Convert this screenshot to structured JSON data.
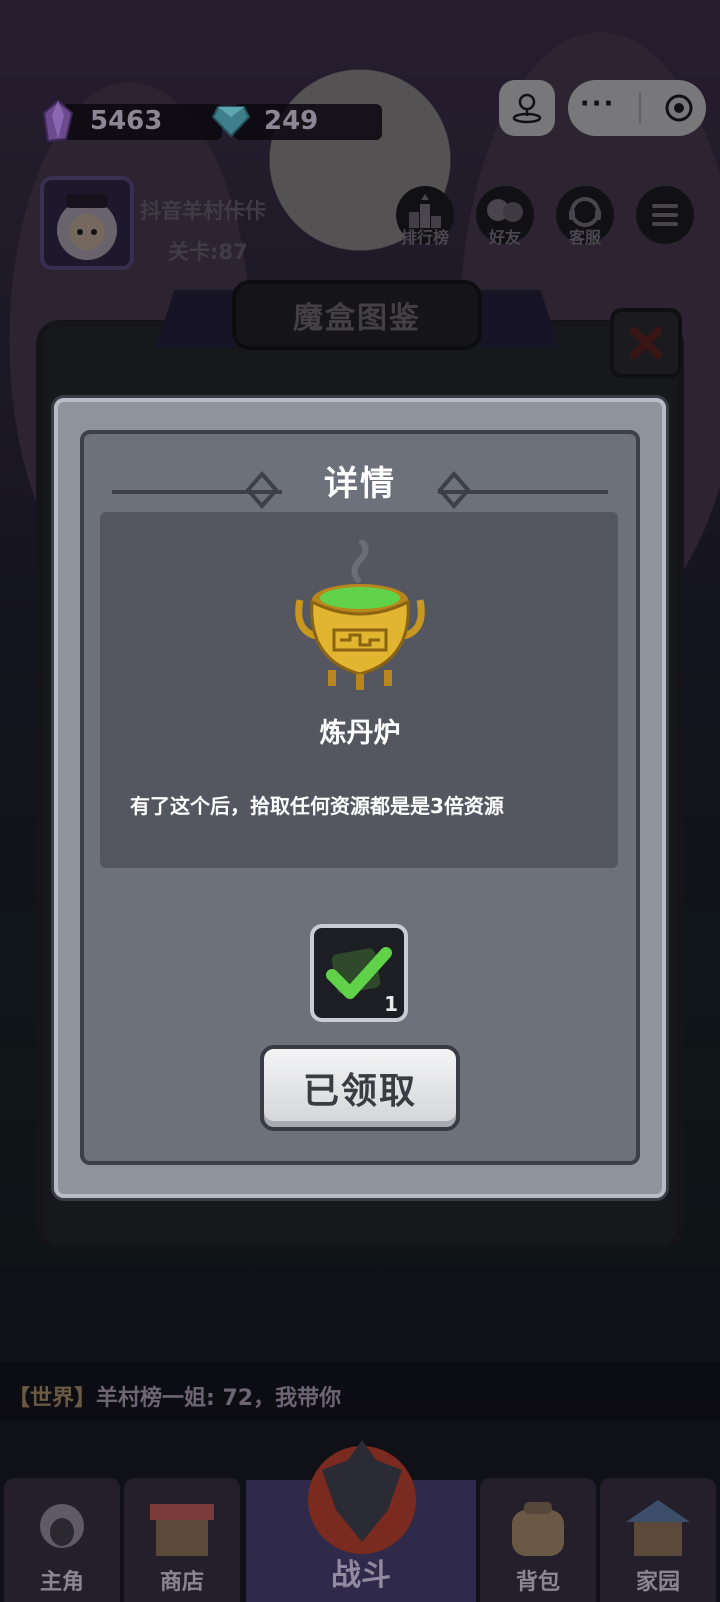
{
  "resources": {
    "crystal": {
      "icon": "purple-crystal-icon",
      "value": "5463"
    },
    "diamond": {
      "icon": "blue-diamond-icon",
      "value": "249"
    }
  },
  "miniprogram": {
    "share_icon": "joystick-icon",
    "more_icon": "more-dots-icon",
    "exit_icon": "record-target-icon"
  },
  "profile": {
    "username": "抖音羊村佧佧",
    "level": "关卡:87"
  },
  "top_menu": [
    {
      "icon": "ranking-icon",
      "label": "排行榜"
    },
    {
      "icon": "friends-icon",
      "label": "好友"
    },
    {
      "icon": "support-icon",
      "label": "客服"
    },
    {
      "icon": "menu-icon",
      "label": ""
    }
  ],
  "back_panel": {
    "title": "魔盒图鉴"
  },
  "detail_modal": {
    "title": "详情",
    "item_icon": "alchemy-furnace-icon",
    "item_name": "炼丹炉",
    "item_description": "有了这个后，拾取任何资源都是是3倍资源",
    "reward": {
      "icon": "checkmark-icon",
      "count": "1"
    },
    "claim_button": "已领取"
  },
  "chat": {
    "channel": "【世界】",
    "message": "羊村榜一姐: 72，我带你"
  },
  "bottom_nav": [
    {
      "icon": "sheep-icon",
      "label": "主角"
    },
    {
      "icon": "shop-icon",
      "label": "商店"
    },
    {
      "icon": "wolf-icon",
      "label": "战斗"
    },
    {
      "icon": "backpack-icon",
      "label": "背包"
    },
    {
      "icon": "home-icon",
      "label": "家园"
    }
  ],
  "colors": {
    "accent_green": "#5fd24a",
    "gold": "#d9a92a",
    "panel_grey": "#6d717c"
  }
}
